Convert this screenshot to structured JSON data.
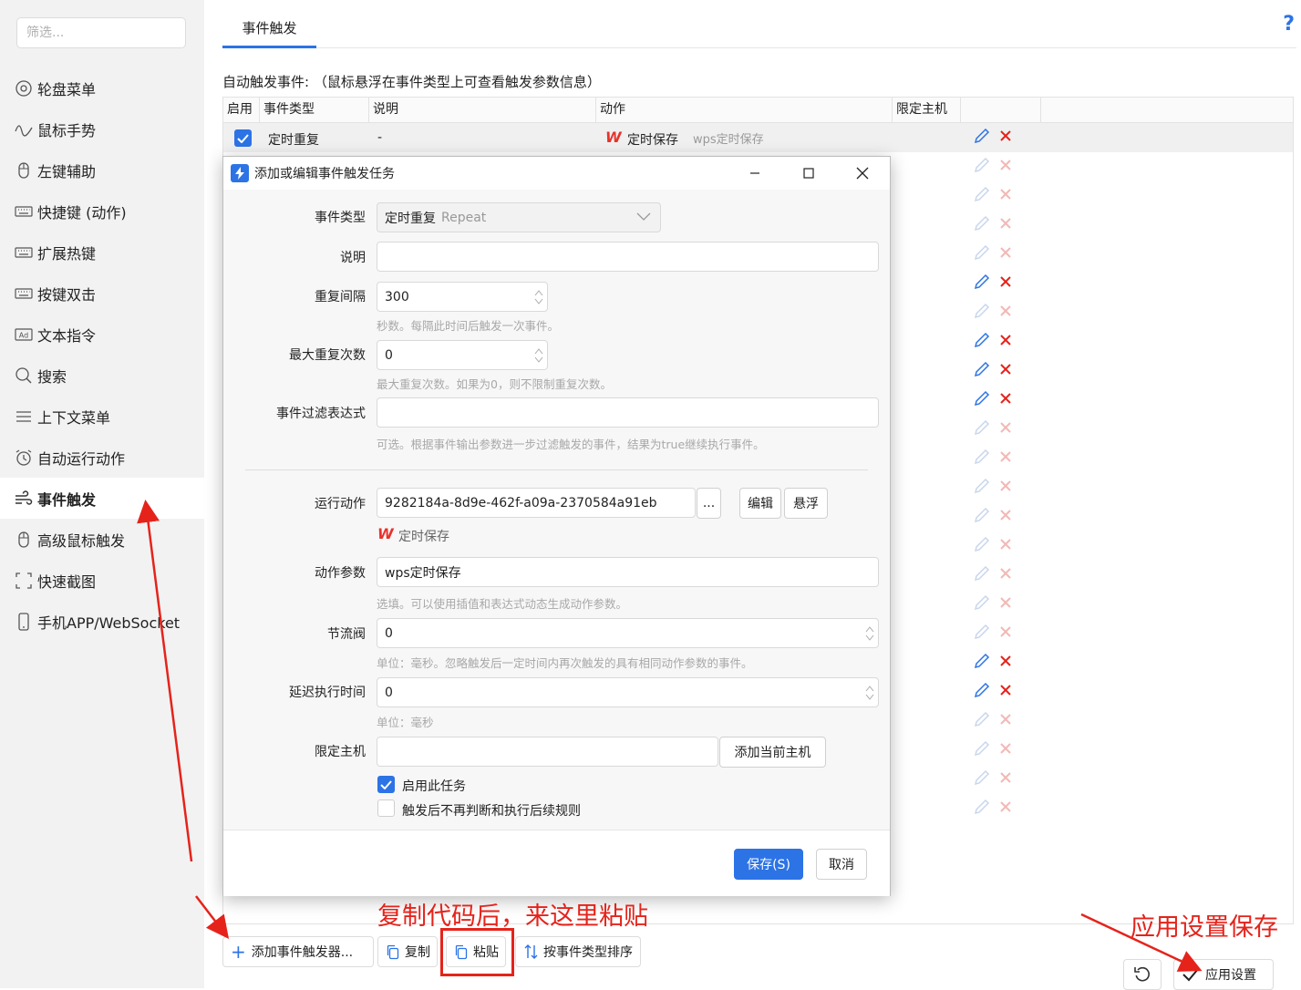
{
  "sidebar": {
    "filter_placeholder": "筛选...",
    "items": [
      {
        "label": "轮盘菜单",
        "icon": "wheel-icon"
      },
      {
        "label": "鼠标手势",
        "icon": "gesture-icon"
      },
      {
        "label": "左键辅助",
        "icon": "mouse-icon"
      },
      {
        "label": "快捷键 (动作)",
        "icon": "keyboard-icon"
      },
      {
        "label": "扩展热键",
        "icon": "keyboard-icon"
      },
      {
        "label": "按键双击",
        "icon": "keyboard-icon"
      },
      {
        "label": "文本指令",
        "icon": "ad-icon"
      },
      {
        "label": "搜索",
        "icon": "search-icon"
      },
      {
        "label": "上下文菜单",
        "icon": "menu-icon"
      },
      {
        "label": "自动运行动作",
        "icon": "alarm-icon"
      },
      {
        "label": "事件触发",
        "icon": "wind-icon",
        "active": true
      },
      {
        "label": "高级鼠标触发",
        "icon": "mouse-icon"
      },
      {
        "label": "快速截图",
        "icon": "screenshot-icon"
      },
      {
        "label": "手机APP/WebSocket",
        "icon": "phone-icon"
      }
    ]
  },
  "main": {
    "tab": "事件触发",
    "help": "?",
    "caption": "自动触发事件: （鼠标悬浮在事件类型上可查看触发参数信息）",
    "columns": [
      "启用",
      "事件类型",
      "说明",
      "动作",
      "限定主机",
      ""
    ],
    "row": {
      "type": "定时重复",
      "desc": "-",
      "action": "定时保存",
      "param": "wps定时保存"
    },
    "action_rows": 24
  },
  "dialog": {
    "title": "添加或编辑事件触发任务",
    "fields": {
      "event_type_label": "事件类型",
      "event_type_value": "定时重复",
      "event_type_en": "Repeat",
      "desc_label": "说明",
      "desc_value": "",
      "interval_label": "重复间隔",
      "interval_value": "300",
      "interval_hint": "秒数。每隔此时间后触发一次事件。",
      "max_label": "最大重复次数",
      "max_value": "0",
      "max_hint": "最大重复次数。如果为0，则不限制重复次数。",
      "filter_label": "事件过滤表达式",
      "filter_value": "",
      "filter_hint": "可选。根据事件输出参数进一步过滤触发的事件，结果为true继续执行事件。",
      "action_label": "运行动作",
      "action_value": "9282184a-8d9e-462f-a09a-2370584a91eb",
      "action_more": "...",
      "action_edit": "编辑",
      "action_float": "悬浮",
      "action_name": "定时保存",
      "param_label": "动作参数",
      "param_value": "wps定时保存",
      "param_hint": "选填。可以使用插值和表达式动态生成动作参数。",
      "throttle_label": "节流阀",
      "throttle_value": "0",
      "throttle_hint": "单位：毫秒。忽略触发后一定时间内再次触发的具有相同动作参数的事件。",
      "delay_label": "延迟执行时间",
      "delay_value": "0",
      "delay_hint": "单位：毫秒",
      "host_label": "限定主机",
      "host_value": "",
      "host_add": "添加当前主机",
      "enable_label": "启用此任务",
      "stop_label": "触发后不再判断和执行后续规则"
    },
    "save": "保存(S)",
    "cancel": "取消"
  },
  "bottom": {
    "add": "添加事件触发器...",
    "copy": "复制",
    "paste": "粘贴",
    "sort": "按事件类型排序",
    "apply": "应用设置"
  },
  "annotations": {
    "paste_note": "复制代码后，来这里粘贴",
    "apply_note": "应用设置保存"
  },
  "colors": {
    "accent": "#2c73e6",
    "danger": "#e5231b",
    "wps": "#e8322b"
  }
}
